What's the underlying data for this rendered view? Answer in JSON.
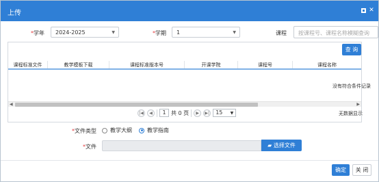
{
  "dialog": {
    "title": "上传",
    "max_icon": "maximize-icon",
    "close_icon": "close-icon"
  },
  "filters": {
    "year_label": "学年",
    "year_value": "2024-2025",
    "term_label": "学期",
    "term_value": "1",
    "course_label": "课程",
    "course_placeholder": "按课程号、课程名称模糊查询"
  },
  "query_button": "查 询",
  "table": {
    "columns": [
      "课程标准文件",
      "教学模板下载",
      "课程标准版本号",
      "开课学院",
      "课程号",
      "课程名称"
    ],
    "empty_message": "没有符合条件记录"
  },
  "pager": {
    "current_page": "1",
    "total_text": "共 0 页",
    "page_size": "15",
    "no_data_text": "无数据显示"
  },
  "form": {
    "file_type_label": "文件类型",
    "file_type_options": [
      "教学大纲",
      "教学指南"
    ],
    "file_type_selected": "教学指南",
    "file_label": "文件",
    "choose_file_button": "选择文件"
  },
  "footer": {
    "ok_button": "确定",
    "close_button": "关 闭"
  },
  "colors": {
    "accent": "#2f7fd6",
    "required": "#e4393c"
  }
}
